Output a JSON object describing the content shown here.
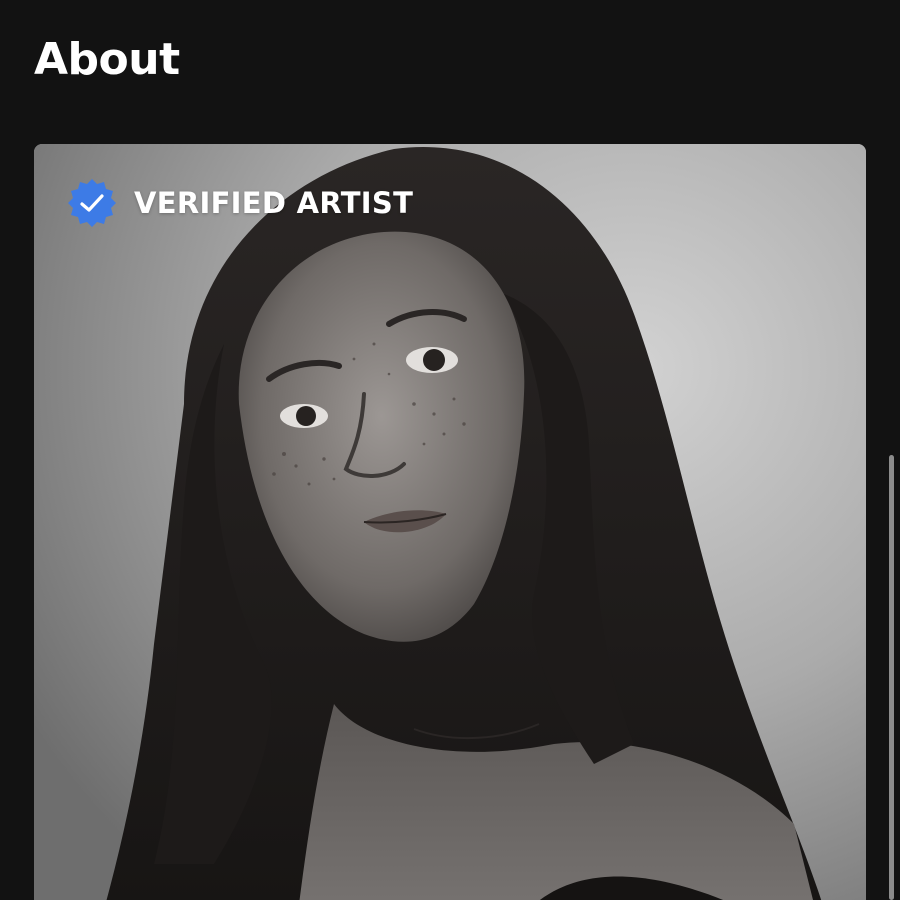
{
  "about": {
    "title": "About",
    "verified_label": "VERIFIED ARTIST",
    "verified_icon": "verified-check-icon",
    "photo_description": "artist-portrait"
  },
  "colors": {
    "background": "#121212",
    "verified_badge": "#3d7be6",
    "text": "#ffffff",
    "scrollbar": "#8c8c8c"
  }
}
